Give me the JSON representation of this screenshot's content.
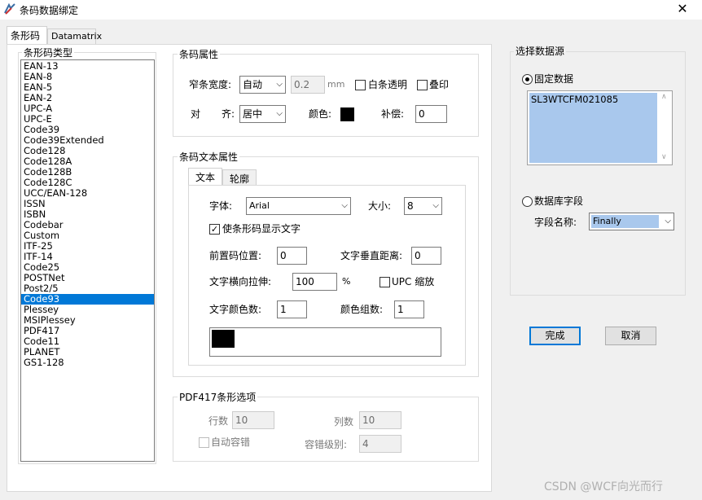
{
  "window": {
    "title": "条码数据绑定",
    "close_glyph": "✕"
  },
  "tabs": [
    {
      "label": "条形码"
    },
    {
      "label": "Datamatrix"
    }
  ],
  "barcode_type": {
    "legend": "条形码类型",
    "items": [
      "EAN-13",
      "EAN-8",
      "EAN-5",
      "EAN-2",
      "UPC-A",
      "UPC-E",
      "Code39",
      "Code39Extended",
      "Code128",
      "Code128A",
      "Code128B",
      "Code128C",
      "UCC/EAN-128",
      "ISSN",
      "ISBN",
      "Codebar",
      "Custom",
      "ITF-25",
      "ITF-14",
      "Code25",
      "POSTNet",
      "Post2/5",
      "Code93",
      "Plessey",
      "MSIPlessey",
      "PDF417",
      "Code11",
      "PLANET",
      "GS1-128"
    ],
    "selected": "Code93"
  },
  "barcode_props": {
    "legend": "条码属性",
    "bar_width_label": "窄条宽度:",
    "bar_width_value": "自动",
    "bar_width_number": "0.2",
    "bar_width_unit": "mm",
    "white_transparent_label": "白条透明",
    "overprint_label": "叠印",
    "align_label_1": "对",
    "align_label_2": "齐:",
    "align_value": "居中",
    "color_label": "颜色:",
    "color_value": "#000000",
    "compensate_label": "补偿:",
    "compensate_value": "0"
  },
  "barcode_text": {
    "legend": "条码文本属性",
    "tab_text": "文本",
    "tab_outline": "轮廓",
    "font_label": "字体:",
    "font_value": "Arial",
    "size_label": "大小:",
    "size_value": "8",
    "show_text_label": "使条形码显示文字",
    "show_text_checked": "✓",
    "prefix_pos_label": "前置码位置:",
    "prefix_pos_value": "0",
    "vert_dist_label": "文字垂直距离:",
    "vert_dist_value": "0",
    "h_stretch_label": "文字横向拉伸:",
    "h_stretch_value": "100",
    "h_stretch_unit": "%",
    "upc_scale_label": "UPC 缩放",
    "color_count_label": "文字颜色数:",
    "color_count_value": "1",
    "color_group_label": "颜色组数:",
    "color_group_value": "1",
    "text_color": "#000000"
  },
  "pdf417": {
    "legend": "PDF417条形选项",
    "rows_label": "行数",
    "rows_value": "10",
    "cols_label": "列数",
    "cols_value": "10",
    "auto_ec_label": "自动容错",
    "ec_level_label": "容错级别:",
    "ec_level_value": "4"
  },
  "data_source": {
    "legend": "选择数据源",
    "fixed_label": "固定数据",
    "fixed_value": "SL3WTCFM021085",
    "db_label": "数据库字段",
    "field_name_label": "字段名称:",
    "field_name_value": "Finally"
  },
  "buttons": {
    "ok": "完成",
    "cancel": "取消"
  },
  "watermark": "CSDN @WCF向光而行"
}
